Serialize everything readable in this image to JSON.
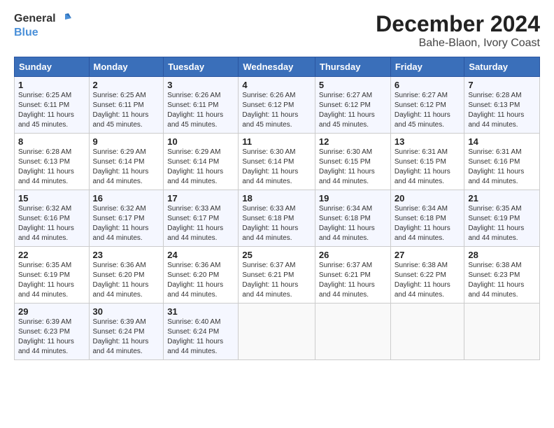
{
  "header": {
    "logo_line1": "General",
    "logo_line2": "Blue",
    "title": "December 2024",
    "subtitle": "Bahe-Blaon, Ivory Coast"
  },
  "calendar": {
    "days_of_week": [
      "Sunday",
      "Monday",
      "Tuesday",
      "Wednesday",
      "Thursday",
      "Friday",
      "Saturday"
    ],
    "weeks": [
      [
        {
          "day": null,
          "info": ""
        },
        {
          "day": null,
          "info": ""
        },
        {
          "day": null,
          "info": ""
        },
        {
          "day": null,
          "info": ""
        },
        {
          "day": null,
          "info": ""
        },
        {
          "day": null,
          "info": ""
        },
        {
          "day": null,
          "info": ""
        }
      ],
      [
        {
          "day": "1",
          "info": "Sunrise: 6:25 AM\nSunset: 6:11 PM\nDaylight: 11 hours\nand 45 minutes."
        },
        {
          "day": "2",
          "info": "Sunrise: 6:25 AM\nSunset: 6:11 PM\nDaylight: 11 hours\nand 45 minutes."
        },
        {
          "day": "3",
          "info": "Sunrise: 6:26 AM\nSunset: 6:11 PM\nDaylight: 11 hours\nand 45 minutes."
        },
        {
          "day": "4",
          "info": "Sunrise: 6:26 AM\nSunset: 6:12 PM\nDaylight: 11 hours\nand 45 minutes."
        },
        {
          "day": "5",
          "info": "Sunrise: 6:27 AM\nSunset: 6:12 PM\nDaylight: 11 hours\nand 45 minutes."
        },
        {
          "day": "6",
          "info": "Sunrise: 6:27 AM\nSunset: 6:12 PM\nDaylight: 11 hours\nand 45 minutes."
        },
        {
          "day": "7",
          "info": "Sunrise: 6:28 AM\nSunset: 6:13 PM\nDaylight: 11 hours\nand 44 minutes."
        }
      ],
      [
        {
          "day": "8",
          "info": "Sunrise: 6:28 AM\nSunset: 6:13 PM\nDaylight: 11 hours\nand 44 minutes."
        },
        {
          "day": "9",
          "info": "Sunrise: 6:29 AM\nSunset: 6:14 PM\nDaylight: 11 hours\nand 44 minutes."
        },
        {
          "day": "10",
          "info": "Sunrise: 6:29 AM\nSunset: 6:14 PM\nDaylight: 11 hours\nand 44 minutes."
        },
        {
          "day": "11",
          "info": "Sunrise: 6:30 AM\nSunset: 6:14 PM\nDaylight: 11 hours\nand 44 minutes."
        },
        {
          "day": "12",
          "info": "Sunrise: 6:30 AM\nSunset: 6:15 PM\nDaylight: 11 hours\nand 44 minutes."
        },
        {
          "day": "13",
          "info": "Sunrise: 6:31 AM\nSunset: 6:15 PM\nDaylight: 11 hours\nand 44 minutes."
        },
        {
          "day": "14",
          "info": "Sunrise: 6:31 AM\nSunset: 6:16 PM\nDaylight: 11 hours\nand 44 minutes."
        }
      ],
      [
        {
          "day": "15",
          "info": "Sunrise: 6:32 AM\nSunset: 6:16 PM\nDaylight: 11 hours\nand 44 minutes."
        },
        {
          "day": "16",
          "info": "Sunrise: 6:32 AM\nSunset: 6:17 PM\nDaylight: 11 hours\nand 44 minutes."
        },
        {
          "day": "17",
          "info": "Sunrise: 6:33 AM\nSunset: 6:17 PM\nDaylight: 11 hours\nand 44 minutes."
        },
        {
          "day": "18",
          "info": "Sunrise: 6:33 AM\nSunset: 6:18 PM\nDaylight: 11 hours\nand 44 minutes."
        },
        {
          "day": "19",
          "info": "Sunrise: 6:34 AM\nSunset: 6:18 PM\nDaylight: 11 hours\nand 44 minutes."
        },
        {
          "day": "20",
          "info": "Sunrise: 6:34 AM\nSunset: 6:18 PM\nDaylight: 11 hours\nand 44 minutes."
        },
        {
          "day": "21",
          "info": "Sunrise: 6:35 AM\nSunset: 6:19 PM\nDaylight: 11 hours\nand 44 minutes."
        }
      ],
      [
        {
          "day": "22",
          "info": "Sunrise: 6:35 AM\nSunset: 6:19 PM\nDaylight: 11 hours\nand 44 minutes."
        },
        {
          "day": "23",
          "info": "Sunrise: 6:36 AM\nSunset: 6:20 PM\nDaylight: 11 hours\nand 44 minutes."
        },
        {
          "day": "24",
          "info": "Sunrise: 6:36 AM\nSunset: 6:20 PM\nDaylight: 11 hours\nand 44 minutes."
        },
        {
          "day": "25",
          "info": "Sunrise: 6:37 AM\nSunset: 6:21 PM\nDaylight: 11 hours\nand 44 minutes."
        },
        {
          "day": "26",
          "info": "Sunrise: 6:37 AM\nSunset: 6:21 PM\nDaylight: 11 hours\nand 44 minutes."
        },
        {
          "day": "27",
          "info": "Sunrise: 6:38 AM\nSunset: 6:22 PM\nDaylight: 11 hours\nand 44 minutes."
        },
        {
          "day": "28",
          "info": "Sunrise: 6:38 AM\nSunset: 6:23 PM\nDaylight: 11 hours\nand 44 minutes."
        }
      ],
      [
        {
          "day": "29",
          "info": "Sunrise: 6:39 AM\nSunset: 6:23 PM\nDaylight: 11 hours\nand 44 minutes."
        },
        {
          "day": "30",
          "info": "Sunrise: 6:39 AM\nSunset: 6:24 PM\nDaylight: 11 hours\nand 44 minutes."
        },
        {
          "day": "31",
          "info": "Sunrise: 6:40 AM\nSunset: 6:24 PM\nDaylight: 11 hours\nand 44 minutes."
        },
        {
          "day": null,
          "info": ""
        },
        {
          "day": null,
          "info": ""
        },
        {
          "day": null,
          "info": ""
        },
        {
          "day": null,
          "info": ""
        }
      ]
    ]
  }
}
